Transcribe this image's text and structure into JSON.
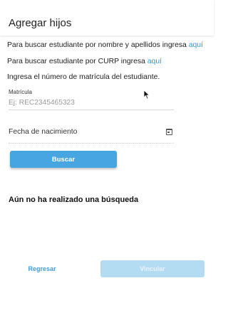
{
  "header": {
    "title": "Agregar hijos"
  },
  "instructions": {
    "by_name_text": "Para buscar estudiante por nombre y apellidos ingresa",
    "by_name_link": "aquí",
    "by_curp_text": "Para buscar estudiante por CURP ingresa",
    "by_curp_link": "aquí",
    "enrollment_text": "Ingresa el número de matrícula del estudiante."
  },
  "form": {
    "matricula_label": "Matrícula",
    "matricula_placeholder": "Ej: REC2345465323",
    "matricula_value": "",
    "birthdate_label": "Fecha de nacimiento",
    "search_button": "Buscar"
  },
  "results": {
    "empty_message": "Aún no ha realizado una búsqueda"
  },
  "footer": {
    "back_button": "Regresar",
    "link_button": "Vincular"
  },
  "colors": {
    "accent": "#47a6e2",
    "link": "#2d9ad6",
    "disabled": "#b3dbf2"
  },
  "icons": {
    "date_field": "calendar-icon",
    "pointer": "mouse-cursor"
  }
}
